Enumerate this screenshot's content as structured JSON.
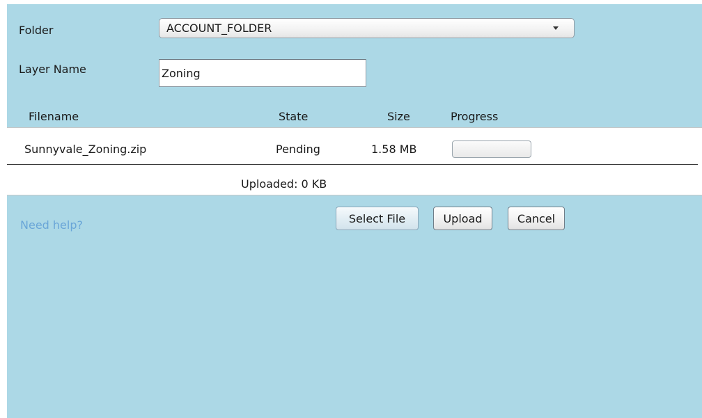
{
  "form": {
    "folder_label": "Folder",
    "folder_value": "ACCOUNT_FOLDER",
    "layer_name_label": "Layer Name",
    "layer_name_value": "Zoning"
  },
  "file_table": {
    "columns": {
      "filename": "Filename",
      "state": "State",
      "size": "Size",
      "progress": "Progress"
    },
    "rows": [
      {
        "filename": "Sunnyvale_Zoning.zip",
        "state": "Pending",
        "size": "1.58 MB",
        "progress": 0
      }
    ],
    "uploaded_summary": "Uploaded: 0 KB"
  },
  "actions": {
    "help_link": "Need help?",
    "select_file": "Select File",
    "upload": "Upload",
    "cancel": "Cancel"
  },
  "colors": {
    "panel_background": "#acd8e6",
    "help_link": "#6aa6d8"
  }
}
